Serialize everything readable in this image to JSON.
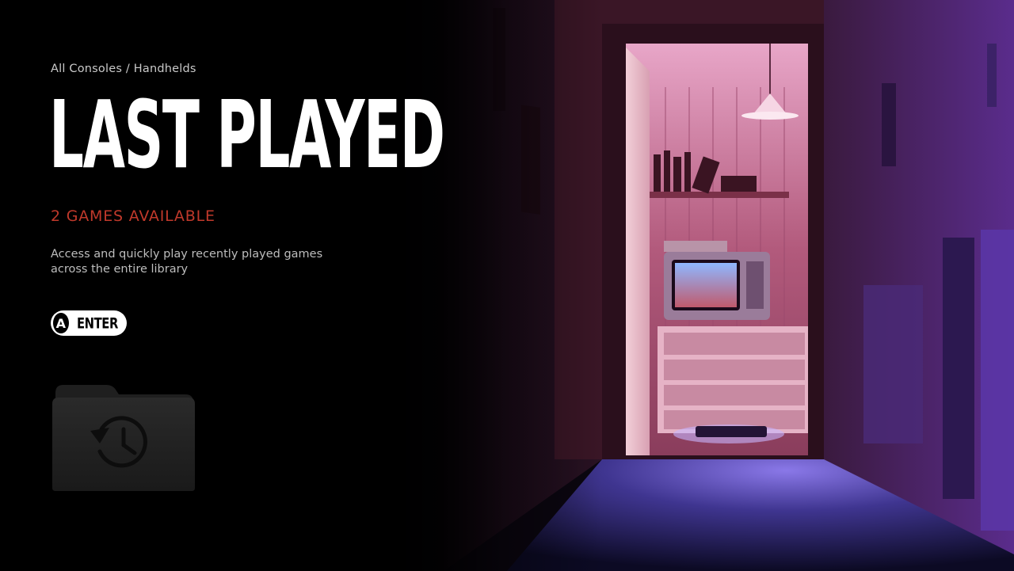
{
  "breadcrumb": "All Consoles / Handhelds",
  "title": "LAST PLAYED",
  "games_count": "2 GAMES AVAILABLE",
  "description": {
    "line1": "Access and quickly play recently played games",
    "line2": "across the entire library"
  },
  "action": {
    "button": "A",
    "label": "ENTER"
  },
  "icons": {
    "collection": "recent-history-folder-icon",
    "button_glyph": "a-button-icon"
  },
  "colors": {
    "background": "#000000",
    "title": "#ffffff",
    "accent": "#c0392b",
    "text_muted": "#bdbdbd"
  }
}
